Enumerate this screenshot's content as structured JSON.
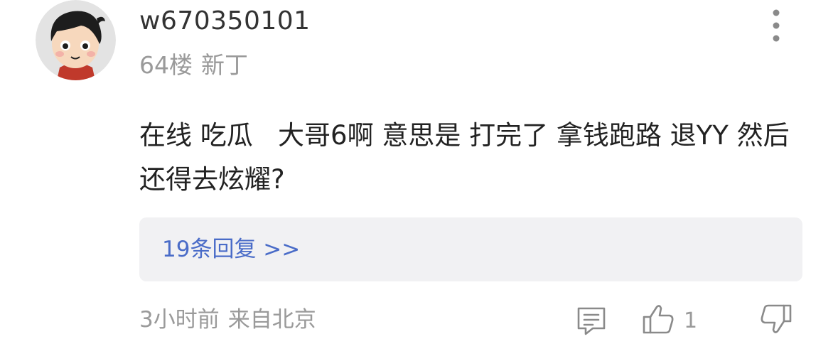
{
  "comment": {
    "username": "w670350101",
    "floor": "64楼",
    "level": "新丁",
    "text": "在线 吃瓜   大哥6啊 意思是 打完了 拿钱跑路 退YY 然后还得去炫耀?",
    "replies_label": "19条回复 >>",
    "time": "3小时前",
    "location": "来自北京",
    "like_count": "1"
  },
  "icons": {
    "more": "more-vertical-icon",
    "comment": "comment-icon",
    "like": "thumbs-up-icon",
    "dislike": "thumbs-down-icon"
  },
  "colors": {
    "link": "#4a6cc8",
    "muted": "#9a9a9a",
    "reply_box_bg": "#f1f1f3"
  }
}
